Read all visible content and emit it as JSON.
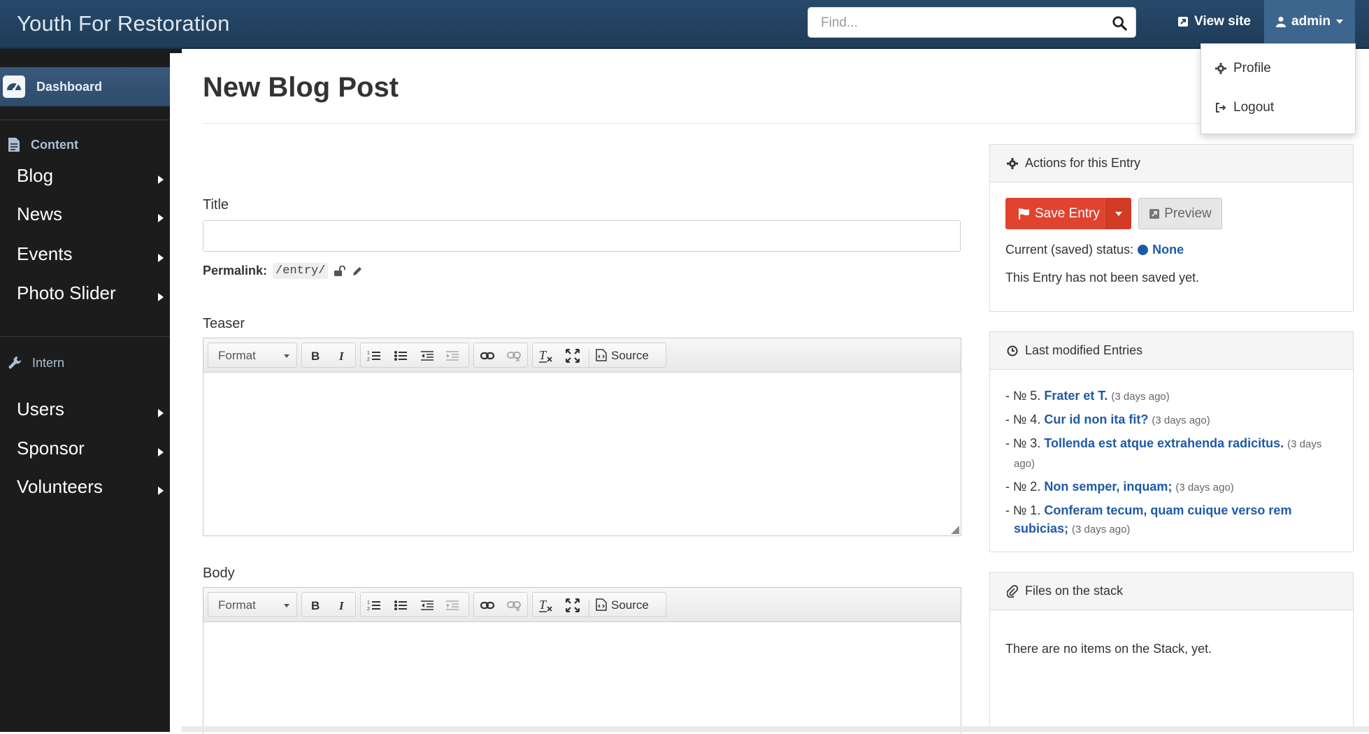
{
  "navbar": {
    "brand": "Youth For Restoration",
    "search_placeholder": "Find...",
    "view_site": "View site",
    "user": "admin",
    "dropdown": [
      "Profile",
      "Logout"
    ]
  },
  "sidebar": {
    "dashboard": "Dashboard",
    "sections": [
      {
        "label": "Content",
        "items": [
          "Blog",
          "News",
          "Events",
          "Photo Slider"
        ]
      },
      {
        "label": "Intern",
        "items": [
          "Users",
          "Sponsor",
          "Volunteers"
        ]
      }
    ]
  },
  "main": {
    "page_title": "New Blog Post",
    "title_label": "Title",
    "title_value": "",
    "permalink_label": "Permalink:",
    "permalink_value": "/entry/",
    "teaser_label": "Teaser",
    "body_label": "Body",
    "editor": {
      "format": "Format",
      "source": "Source"
    }
  },
  "actions_panel": {
    "title": "Actions for this Entry",
    "save": "Save Entry",
    "preview": "Preview",
    "status_label": "Current (saved) status:",
    "status_value": "None",
    "note": "This Entry has not been saved yet."
  },
  "last_modified": {
    "title": "Last modified Entries",
    "entries": [
      {
        "num": "- № 5.",
        "title": "Frater et T.",
        "age": "(3 days ago)"
      },
      {
        "num": "- № 4.",
        "title": "Cur id non ita fit?",
        "age": "(3 days ago)"
      },
      {
        "num": "- № 3.",
        "title": "Tollenda est atque extrahenda radicitus.",
        "age": "(3 days ago)"
      },
      {
        "num": "- № 2.",
        "title": "Non semper, inquam;",
        "age": "(3 days ago)"
      },
      {
        "num": "- № 1.",
        "title": "Conferam tecum, quam cuique verso rem subicias;",
        "age": "(3 days ago)"
      }
    ]
  },
  "files_panel": {
    "title": "Files on the stack",
    "note": "There are no items on the Stack, yet."
  },
  "colors": {
    "navbar": "#234566",
    "accent_blue": "#1f5aa6",
    "save_red": "#e0442f",
    "sidebar_bg": "#1c1c1c"
  }
}
